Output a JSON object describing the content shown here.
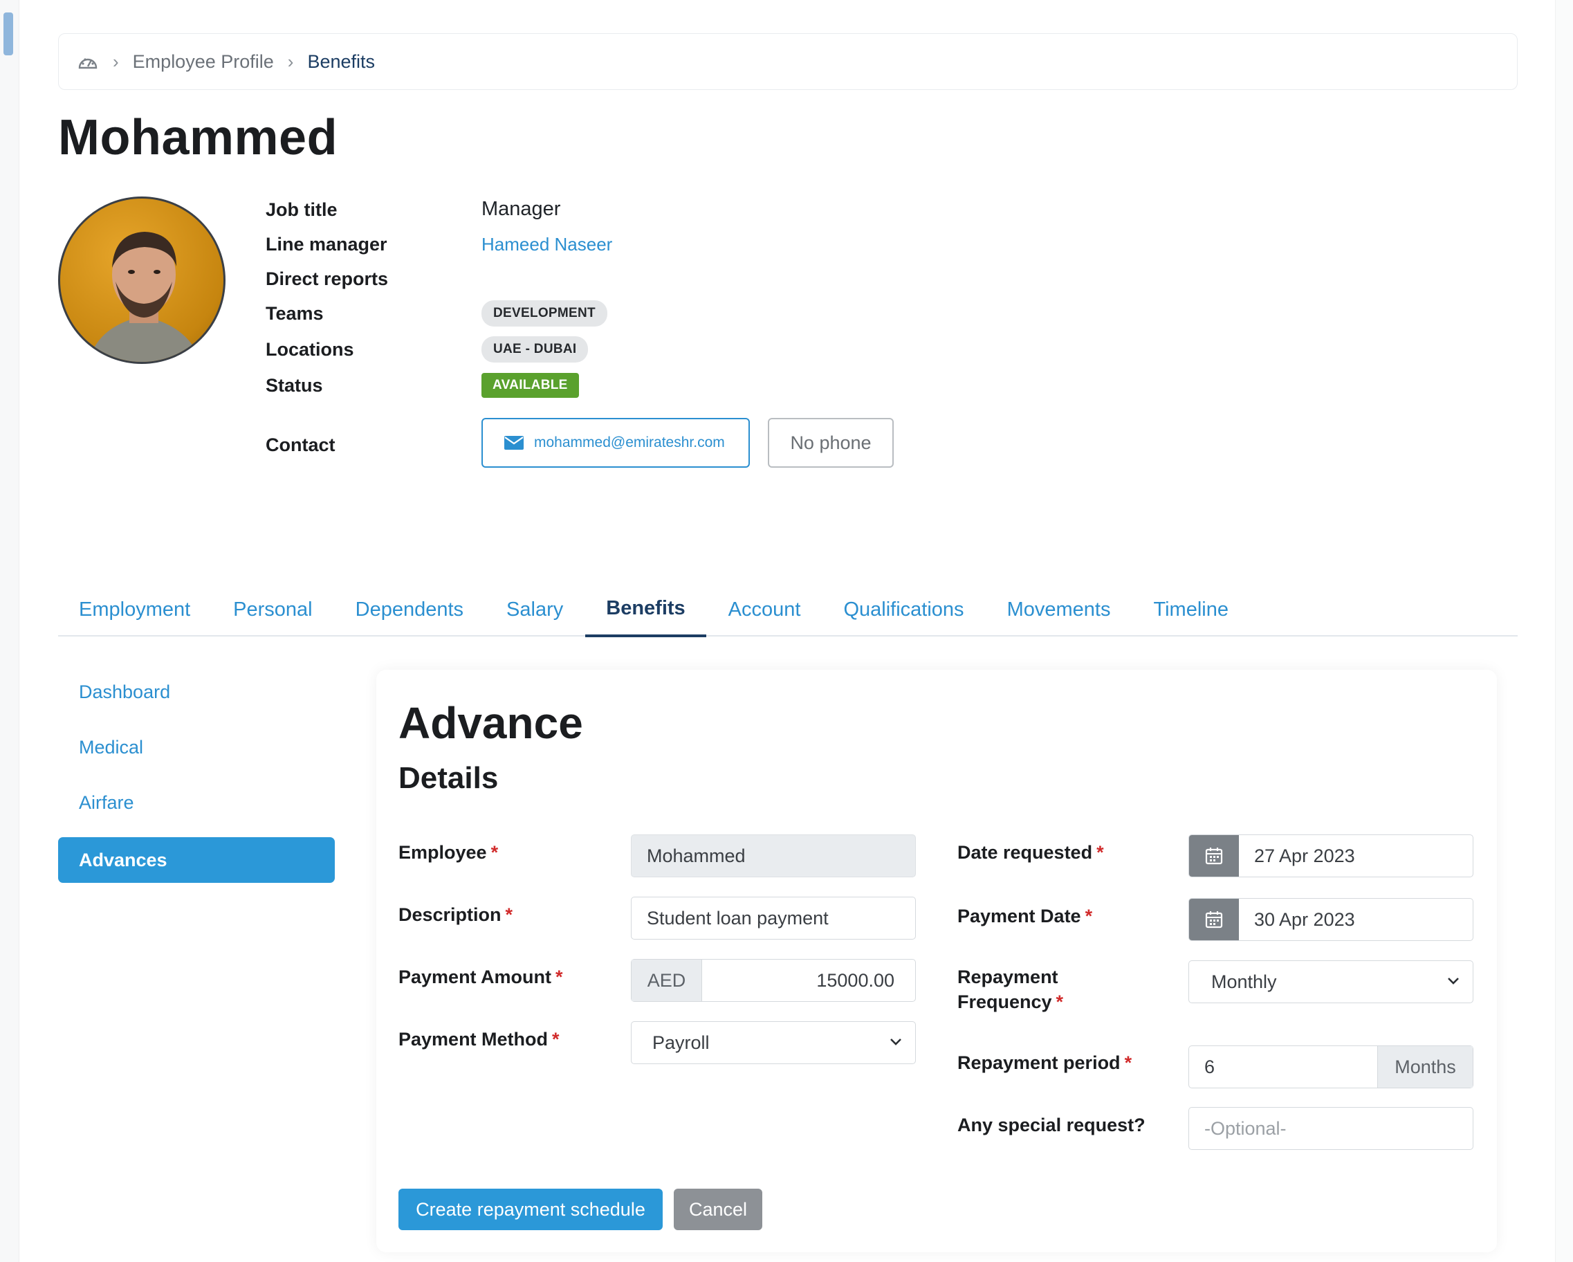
{
  "breadcrumb": {
    "items": [
      "Employee Profile",
      "Benefits"
    ]
  },
  "employee": {
    "name": "Mohammed",
    "labels": {
      "job_title": "Job title",
      "line_manager": "Line manager",
      "direct_reports": "Direct reports",
      "teams": "Teams",
      "locations": "Locations",
      "status": "Status",
      "contact": "Contact"
    },
    "job_title": "Manager",
    "line_manager": "Hameed Naseer",
    "team": "DEVELOPMENT",
    "location": "UAE - DUBAI",
    "status": "AVAILABLE",
    "email": "mohammed@emirateshr.com",
    "phone": "No phone"
  },
  "tabs": [
    "Employment",
    "Personal",
    "Dependents",
    "Salary",
    "Benefits",
    "Account",
    "Qualifications",
    "Movements",
    "Timeline"
  ],
  "active_tab": "Benefits",
  "sidebar": {
    "items": [
      "Dashboard",
      "Medical",
      "Airfare",
      "Advances"
    ],
    "active": "Advances"
  },
  "form": {
    "title": "Advance",
    "subtitle": "Details",
    "employee_label": "Employee",
    "employee_value": "Mohammed",
    "description_label": "Description",
    "description_value": "Student loan payment",
    "amount_label": "Payment Amount",
    "currency": "AED",
    "amount_value": "15000.00",
    "method_label": "Payment Method",
    "method_value": "Payroll",
    "date_requested_label": "Date requested",
    "date_requested_value": "27 Apr 2023",
    "payment_date_label": "Payment Date",
    "payment_date_value": "30 Apr 2023",
    "frequency_label_1": "Repayment",
    "frequency_label_2": "Frequency",
    "frequency_value": "Monthly",
    "period_label": "Repayment period",
    "period_value": "6",
    "period_unit": "Months",
    "special_label": "Any special request?",
    "special_placeholder": "-Optional-",
    "required_mark": "*",
    "create_button": "Create repayment schedule",
    "cancel_button": "Cancel"
  },
  "colors": {
    "accent": "#2b98d8",
    "link": "#2b8fd0",
    "navy": "#1c3d63",
    "available": "#5aa12d",
    "required": "#d12b2b"
  }
}
